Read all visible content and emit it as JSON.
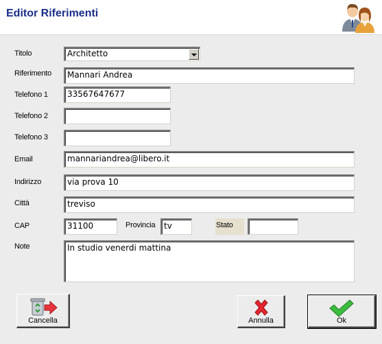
{
  "header": {
    "title": "Editor Riferimenti",
    "icon": "users-icon"
  },
  "form": {
    "titolo": {
      "label": "Titolo",
      "value": "Architetto"
    },
    "riferimento": {
      "label": "Riferimento",
      "value": "Mannari Andrea"
    },
    "telefono1": {
      "label": "Telefono 1",
      "value": "33567647677"
    },
    "telefono2": {
      "label": "Telefono 2",
      "value": ""
    },
    "telefono3": {
      "label": "Telefono 3",
      "value": ""
    },
    "email": {
      "label": "Email",
      "value": "mannariandrea@libero.it"
    },
    "indirizzo": {
      "label": "Indirizzo",
      "value": "via prova 10"
    },
    "citta": {
      "label": "Città",
      "value": "treviso"
    },
    "cap": {
      "label": "CAP",
      "value": "31100"
    },
    "provincia": {
      "label": "Provincia",
      "value": "tv"
    },
    "stato": {
      "label": "Stato",
      "value": ""
    },
    "note": {
      "label": "Note",
      "value": "In studio venerdi mattina"
    }
  },
  "buttons": {
    "cancella": {
      "label": "Cancella",
      "icon": "recycle-bin-arrow-icon"
    },
    "annulla": {
      "label": "Annulla",
      "icon": "red-x-icon"
    },
    "ok": {
      "label": "Ok",
      "icon": "green-check-icon"
    }
  }
}
